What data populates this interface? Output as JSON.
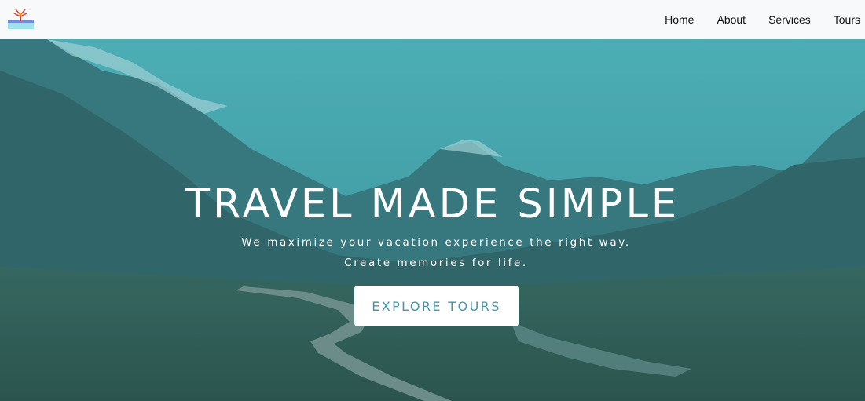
{
  "navbar": {
    "logo_icon": "brand-logo-icon",
    "links": [
      {
        "label": "Home"
      },
      {
        "label": "About"
      },
      {
        "label": "Services"
      },
      {
        "label": "Tours"
      }
    ]
  },
  "hero": {
    "title": "TRAVEL MADE SIMPLE",
    "subtitle": "We maximize your vacation experience the right way. Create memories for life.",
    "button_label": "EXPLORE TOURS",
    "background_image": "mountain-valley-boardwalk"
  },
  "colors": {
    "navbar_bg": "#f8f9fa",
    "button_text": "#3e98ab",
    "hero_tint": "#3f9aa3"
  }
}
